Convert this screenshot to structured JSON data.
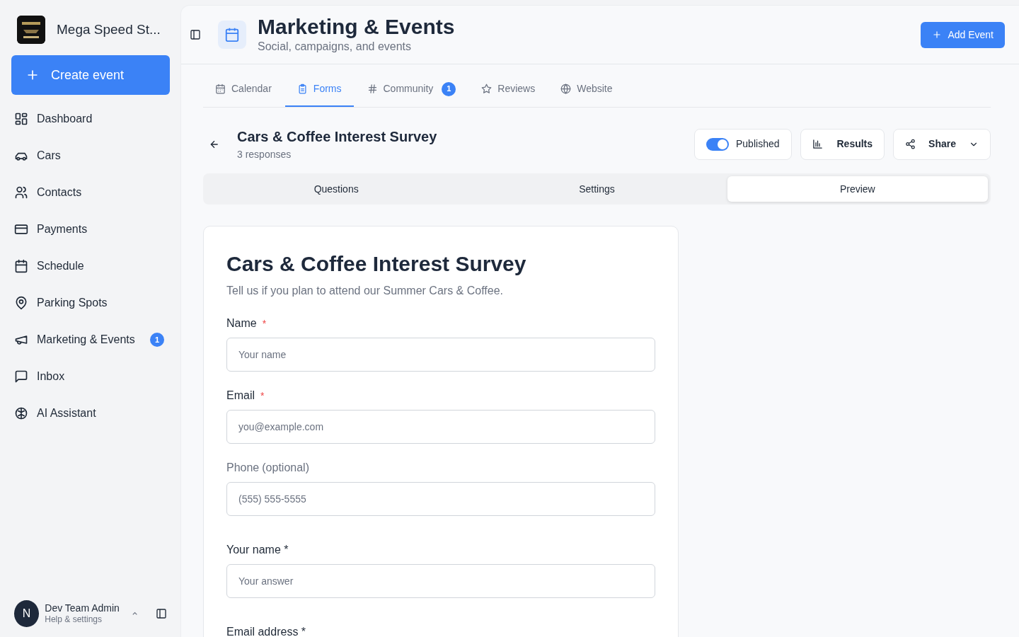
{
  "sidebar": {
    "brand": "Mega Speed St...",
    "create_button": "Create event",
    "items": [
      {
        "label": "Dashboard",
        "selected": false
      },
      {
        "label": "Cars",
        "selected": false
      },
      {
        "label": "Contacts",
        "selected": false
      },
      {
        "label": "Payments",
        "selected": false
      },
      {
        "label": "Schedule",
        "selected": false
      },
      {
        "label": "Parking Spots",
        "selected": false
      },
      {
        "label": "Marketing & Events",
        "selected": false,
        "badge": "1"
      },
      {
        "label": "Inbox",
        "selected": false
      },
      {
        "label": "AI Assistant",
        "selected": false
      }
    ],
    "user": {
      "initial": "N",
      "name": "Dev Team Admin",
      "subtitle": "Help & settings"
    }
  },
  "header": {
    "title": "Marketing & Events",
    "subtitle": "Social, campaigns, and events",
    "add_button": "Add Event"
  },
  "tabs": [
    {
      "label": "Calendar",
      "selected": false
    },
    {
      "label": "Forms",
      "selected": true
    },
    {
      "label": "Community",
      "selected": false,
      "badge": "1"
    },
    {
      "label": "Reviews",
      "selected": false
    },
    {
      "label": "Website",
      "selected": false
    }
  ],
  "form_header": {
    "title": "Cars & Coffee Interest Survey",
    "responses": "3 responses",
    "published": {
      "label": "Published",
      "on": true
    },
    "results_button": "Results",
    "share_button": "Share"
  },
  "segments": [
    {
      "label": "Questions",
      "selected": false
    },
    {
      "label": "Settings",
      "selected": false
    },
    {
      "label": "Preview",
      "selected": true
    }
  ],
  "preview": {
    "title": "Cars & Coffee Interest Survey",
    "description": "Tell us if you plan to attend our Summer Cars & Coffee.",
    "fields": [
      {
        "kind": "required",
        "label": "Name",
        "star": "*",
        "placeholder": "Your name"
      },
      {
        "kind": "required",
        "label": "Email",
        "star": "*",
        "placeholder": "you@example.com"
      },
      {
        "kind": "optional",
        "label": "Phone",
        "note": "(optional)",
        "placeholder": "(555) 555-5555"
      },
      {
        "kind": "plain",
        "label": "Your name *",
        "placeholder": "Your answer"
      },
      {
        "kind": "plain",
        "label": "Email address *"
      }
    ]
  }
}
